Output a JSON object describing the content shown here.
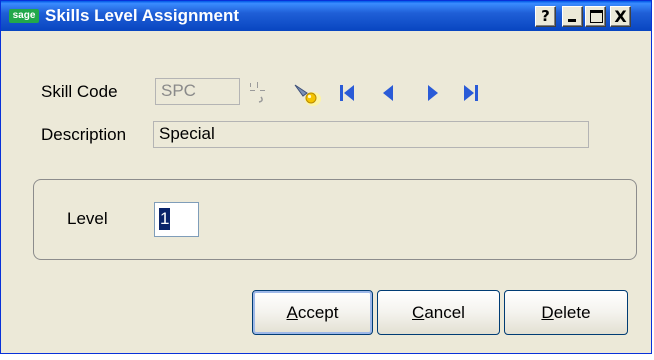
{
  "window": {
    "title": "Skills Level Assignment",
    "app_logo": "sage",
    "buttons": {
      "help": "?",
      "close": "X"
    }
  },
  "form": {
    "skill_code_label": "Skill Code",
    "skill_code_value": "SPC",
    "description_label": "Description",
    "description_value": "Special",
    "level_label": "Level",
    "level_value": "1"
  },
  "nav_icons": [
    "lookup-icon",
    "search-icon",
    "first-record-icon",
    "previous-record-icon",
    "next-record-icon",
    "last-record-icon"
  ],
  "actions": {
    "accept": {
      "mnemonic": "A",
      "rest": "ccept"
    },
    "cancel": {
      "mnemonic": "C",
      "rest": "ancel"
    },
    "delete": {
      "mnemonic": "D",
      "rest": "elete"
    }
  },
  "colors": {
    "title_bar": "#0845c0",
    "nav_arrow": "#2a5bd7",
    "window_bg": "#ece9d8",
    "button_border": "#003c74"
  }
}
